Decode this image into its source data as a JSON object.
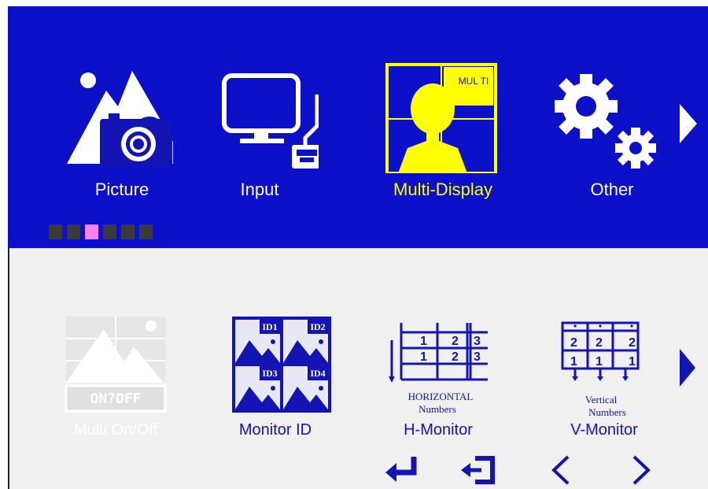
{
  "categories": [
    {
      "label": "Picture",
      "icon": "picture-camera-icon",
      "selected": false
    },
    {
      "label": "Input",
      "icon": "monitor-input-icon",
      "selected": false
    },
    {
      "label": "Multi-Display",
      "icon": "multi-display-icon",
      "selected": true,
      "badge": "MUL TI"
    },
    {
      "label": "Other",
      "icon": "gear-icon",
      "selected": false
    }
  ],
  "page_indicator": {
    "count": 6,
    "active": 3
  },
  "sub_items": [
    {
      "label": "Multi On/Off",
      "icon": "multi-on-off-icon",
      "badge_text": "ON?OFF",
      "enabled": false
    },
    {
      "label": "Monitor ID",
      "icon": "monitor-id-icon",
      "tiles": [
        "ID1",
        "ID2",
        "ID3",
        "ID4"
      ],
      "enabled": true
    },
    {
      "label": "H-Monitor",
      "icon": "h-monitor-icon",
      "caption_line1": "HORIZONTAL",
      "caption_line2": "Numbers",
      "grid_numbers": [
        "1",
        "2",
        "3"
      ],
      "enabled": true
    },
    {
      "label": "V-Monitor",
      "icon": "v-monitor-icon",
      "caption_line1": "Vertical",
      "caption_line2": "Numbers",
      "grid_numbers": [
        "2",
        "1"
      ],
      "enabled": true
    }
  ],
  "nav_buttons": [
    "enter-icon",
    "exit-icon",
    "left-arrow-icon",
    "right-arrow-icon"
  ],
  "colors": {
    "header_bg": "#0d10c9",
    "selected_text": "#ffff00",
    "body_bg": "#f0f0f0",
    "icon_blue": "#1414b4",
    "active_dot": "#ff7ff0"
  }
}
